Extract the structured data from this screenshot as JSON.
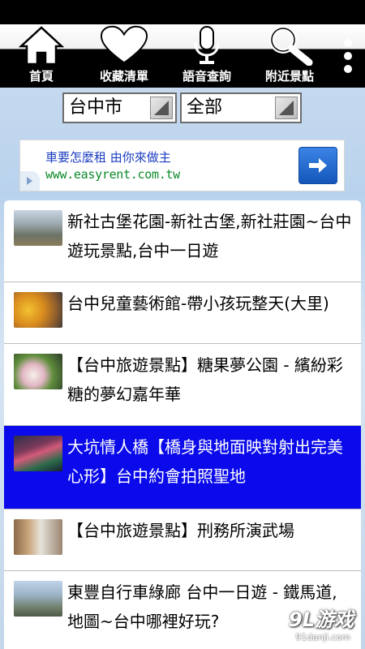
{
  "toolbar": {
    "items": [
      {
        "label": "首頁",
        "icon": "home-icon"
      },
      {
        "label": "收藏清單",
        "icon": "heart-icon"
      },
      {
        "label": "語音查詢",
        "icon": "microphone-icon"
      },
      {
        "label": "附近景點",
        "icon": "search-icon"
      }
    ],
    "more_icon": "more-vertical-icon"
  },
  "filters": {
    "city": "台中市",
    "category": "全部"
  },
  "ad": {
    "headline": "車要怎麼租 由你來做主",
    "url": "www.easyrent.com.tw"
  },
  "list": {
    "items": [
      {
        "title": "新社古堡花園-新社古堡,新社莊園~台中遊玩景點,台中一日遊",
        "selected": false
      },
      {
        "title": "台中兒童藝術館-帶小孩玩整天(大里)",
        "selected": false
      },
      {
        "title": "【台中旅遊景點】糖果夢公園 - 繽紛彩糖的夢幻嘉年華",
        "selected": false
      },
      {
        "title": "大坑情人橋【橋身與地面映對射出完美心形】台中約會拍照聖地",
        "selected": true
      },
      {
        "title": "【台中旅遊景點】刑務所演武場",
        "selected": false
      },
      {
        "title": "東豐自行車綠廊 台中一日遊 - 鐵馬道,地圖~台中哪裡好玩?",
        "selected": false
      }
    ]
  },
  "watermark": {
    "brand": "9L游戏",
    "site": "91danji.com"
  },
  "colors": {
    "selected_row": "#0a0aeb",
    "toolbar": "#000000",
    "ad_link": "#1a3cc0",
    "ad_url": "#0b8a29"
  }
}
